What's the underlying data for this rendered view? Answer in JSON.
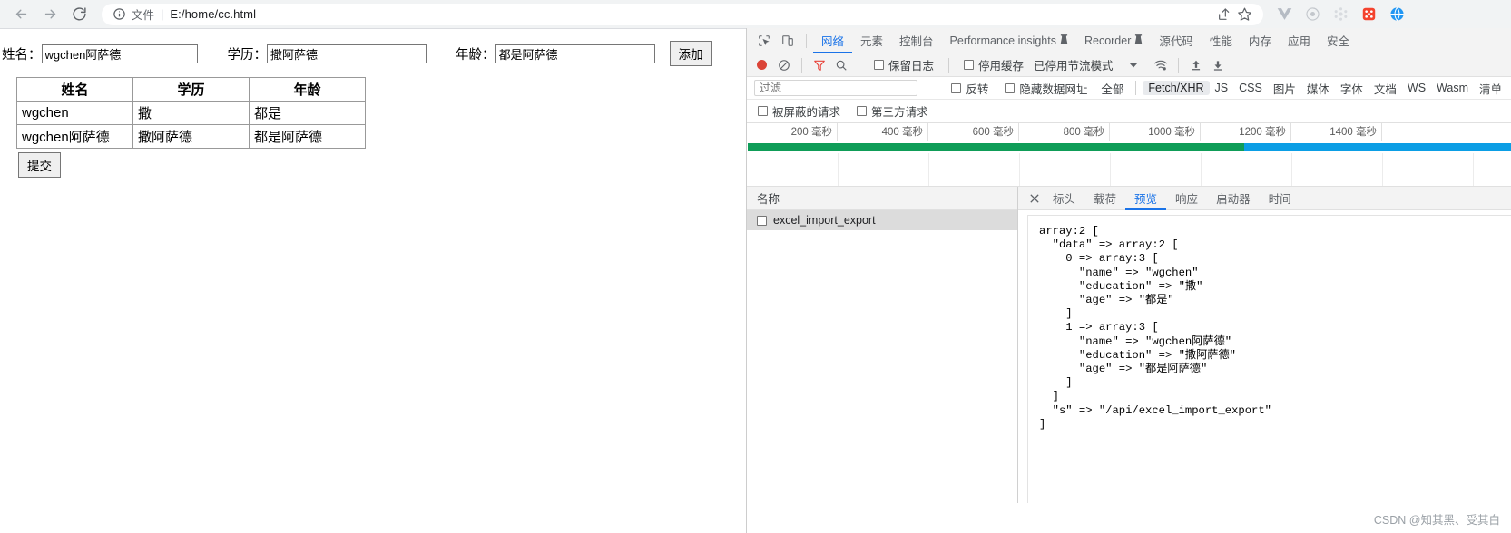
{
  "browser": {
    "back_icon": "arrow-left-icon",
    "forward_icon": "arrow-right-icon",
    "reload_icon": "reload-icon",
    "info_icon": "info-circle-icon",
    "scheme_label": "文件",
    "separator": "|",
    "url": "E:/home/cc.html",
    "share_icon": "share-icon",
    "bookmark_icon": "star-icon",
    "extensions": [
      "vue-devtools-icon",
      "ring-extension-icon",
      "molecule-extension-icon",
      "dice-extension-icon",
      "blue-globe-extension-icon"
    ]
  },
  "page": {
    "fields": [
      {
        "label": "姓名：",
        "value": "wgchen阿萨德",
        "name": "name-input"
      },
      {
        "label": "学历：",
        "value": "撒阿萨德",
        "name": "education-input"
      },
      {
        "label": "年龄：",
        "value": "都是阿萨德",
        "name": "age-input"
      }
    ],
    "add_button": "添加",
    "submit_button": "提交",
    "table": {
      "headers": [
        "姓名",
        "学历",
        "年龄"
      ],
      "rows": [
        [
          "wgchen",
          "撒",
          "都是"
        ],
        [
          "wgchen阿萨德",
          "撒阿萨德",
          "都是阿萨德"
        ]
      ]
    }
  },
  "devtools": {
    "inspect_icon": "inspect-element-icon",
    "device_icon": "device-toolbar-icon",
    "tabs": [
      {
        "label": "网络",
        "active": true,
        "warn": false
      },
      {
        "label": "元素",
        "active": false,
        "warn": false
      },
      {
        "label": "控制台",
        "active": false,
        "warn": false
      },
      {
        "label": "Performance insights",
        "active": false,
        "warn": true
      },
      {
        "label": "Recorder",
        "active": false,
        "warn": true
      },
      {
        "label": "源代码",
        "active": false,
        "warn": false
      },
      {
        "label": "性能",
        "active": false,
        "warn": false
      },
      {
        "label": "内存",
        "active": false,
        "warn": false
      },
      {
        "label": "应用",
        "active": false,
        "warn": false
      },
      {
        "label": "安全",
        "active": false,
        "warn": false
      }
    ],
    "toolbar": {
      "record_icon": "record-button-icon",
      "clear_icon": "clear-network-log-icon",
      "filter_icon": "filter-icon",
      "search_icon": "search-icon",
      "preserve_log": "保留日志",
      "disable_cache": "停用缓存",
      "throttling": "已停用节流模式",
      "dropdown_icon": "chevron-down-icon",
      "network_conditions_icon": "wifi-settings-icon",
      "import_icon": "upload-har-icon",
      "export_icon": "download-har-icon"
    },
    "filterbar": {
      "filter_placeholder": "过滤",
      "invert": "反转",
      "hide_data_urls": "隐藏数据网址",
      "types": [
        "全部",
        "Fetch/XHR",
        "JS",
        "CSS",
        "图片",
        "媒体",
        "字体",
        "文档",
        "WS",
        "Wasm",
        "清单"
      ],
      "selected_type": "Fetch/XHR",
      "blocked_requests": "被屏蔽的请求",
      "third_party_requests": "第三方请求"
    },
    "timeline": {
      "ticks": [
        "200 毫秒",
        "400 毫秒",
        "600 毫秒",
        "800 毫秒",
        "1000 毫秒",
        "1200 毫秒",
        "1400 毫秒"
      ],
      "green_color": "#0f9d58",
      "blue_color": "#0b9ee5"
    },
    "requests": {
      "column_header": "名称",
      "rows": [
        {
          "name": "excel_import_export"
        }
      ]
    },
    "detail": {
      "close_icon": "close-icon",
      "tabs": [
        "标头",
        "载荷",
        "预览",
        "响应",
        "启动器",
        "时间"
      ],
      "active_tab": "预览",
      "preview_text": "array:2 [\n  \"data\" => array:2 [\n    0 => array:3 [\n      \"name\" => \"wgchen\"\n      \"education\" => \"撒\"\n      \"age\" => \"都是\"\n    ]\n    1 => array:3 [\n      \"name\" => \"wgchen阿萨德\"\n      \"education\" => \"撒阿萨德\"\n      \"age\" => \"都是阿萨德\"\n    ]\n  ]\n  \"s\" => \"/api/excel_import_export\"\n]"
    }
  },
  "watermark": "CSDN @知其黑、受其白"
}
